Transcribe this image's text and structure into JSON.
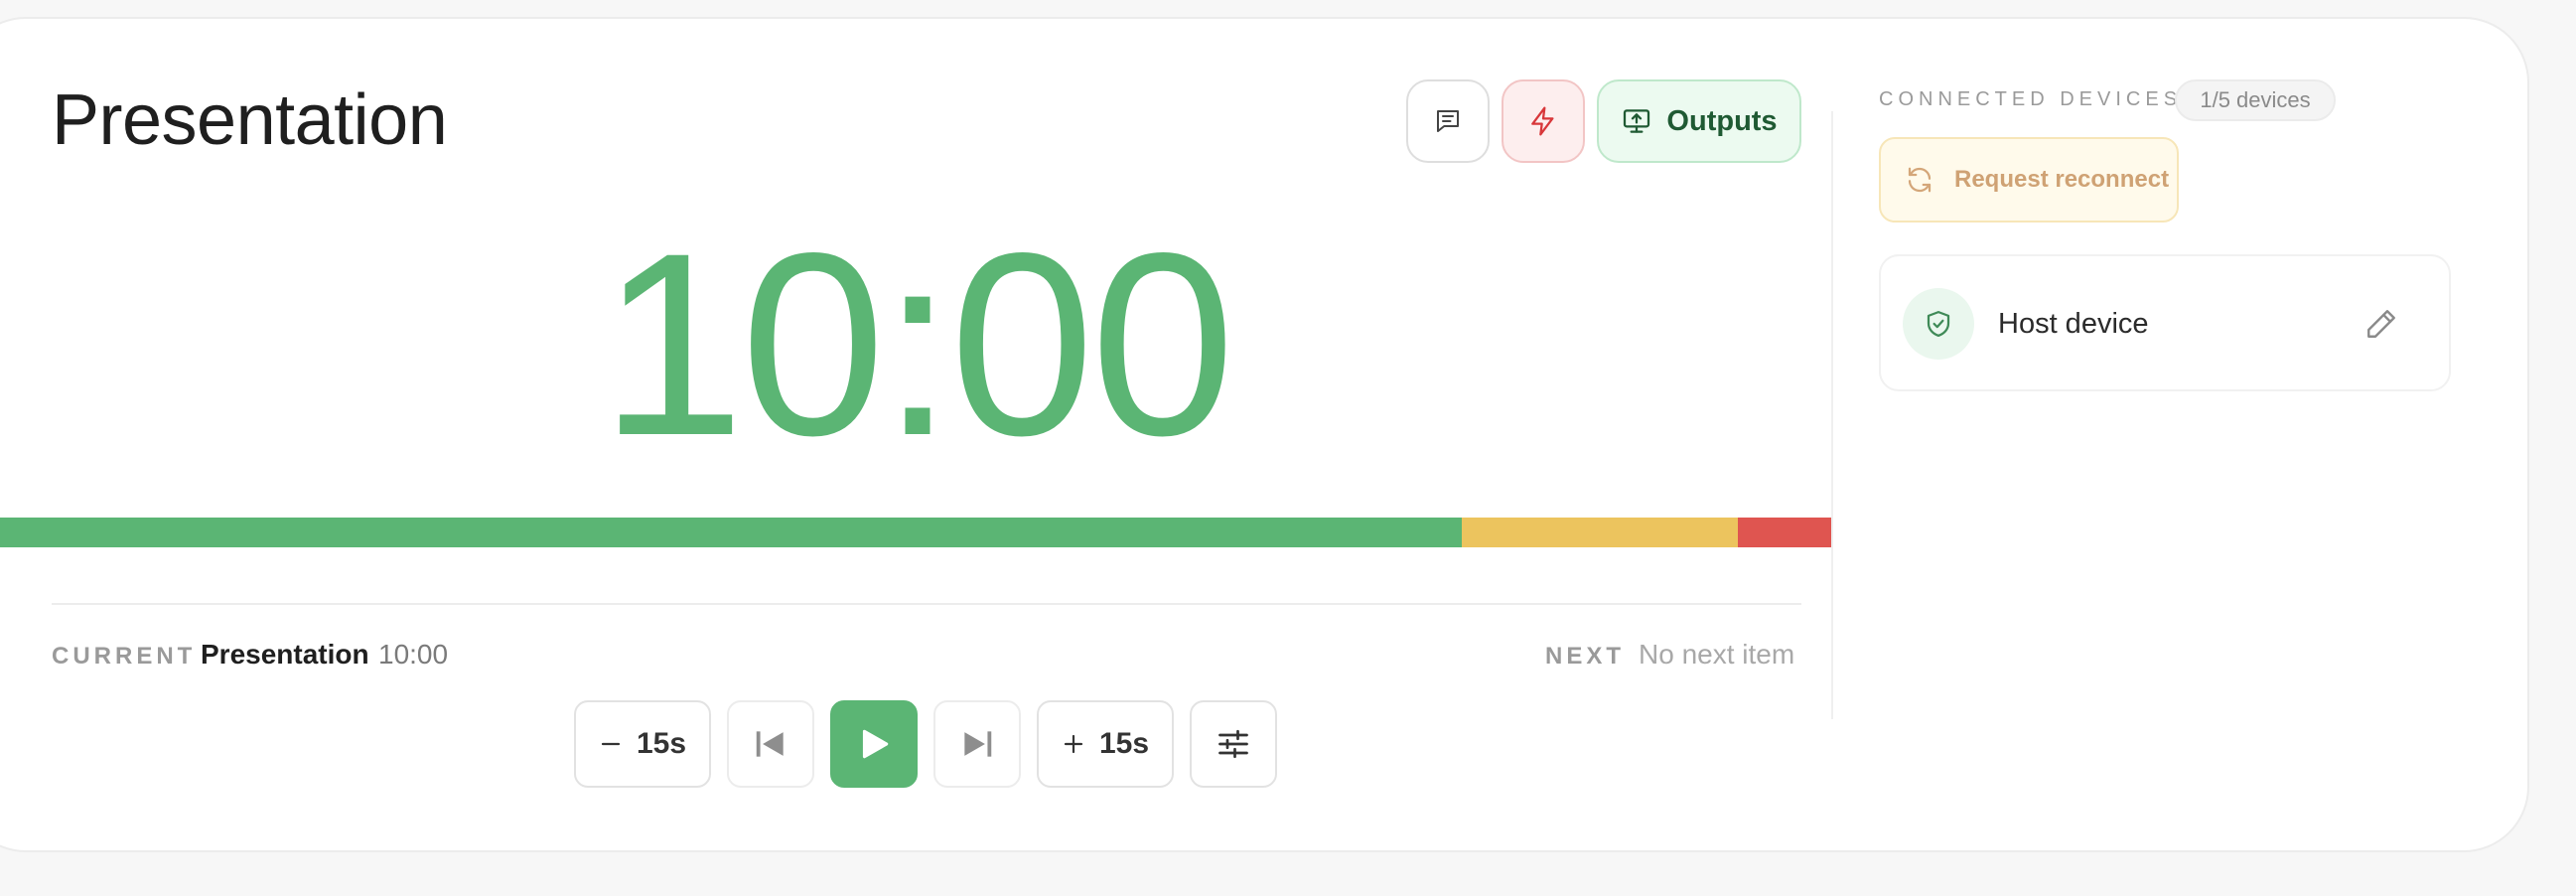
{
  "header": {
    "title": "Presentation"
  },
  "toolbar": {
    "outputs_label": "Outputs",
    "notes_icon": "message-square-icon",
    "flash_icon": "lightning-icon",
    "outputs_icon": "monitor-upload-icon"
  },
  "timer": {
    "display": "10:00",
    "color": "#5bb574"
  },
  "progress": {
    "segments": [
      {
        "status": "green",
        "fraction": 0.798,
        "color": "#5bb574"
      },
      {
        "status": "yellow",
        "fraction": 0.151,
        "color": "#ecc45e"
      },
      {
        "status": "red",
        "fraction": 0.051,
        "color": "#df5550"
      }
    ]
  },
  "current": {
    "label": "CURRENT",
    "name": "Presentation",
    "time": "10:00"
  },
  "next": {
    "label": "NEXT",
    "value": "No next item"
  },
  "controls": {
    "minus_label": "15s",
    "plus_label": "15s"
  },
  "devices": {
    "section_label": "CONNECTED DEVICES",
    "count_badge": "1/5 devices",
    "reconnect_label": "Request reconnect",
    "items": [
      {
        "name": "Host device",
        "icon": "shield-check-icon"
      }
    ]
  },
  "colors": {
    "accent": "#5bb574",
    "warning": "#ecc45e",
    "danger": "#df5550"
  }
}
